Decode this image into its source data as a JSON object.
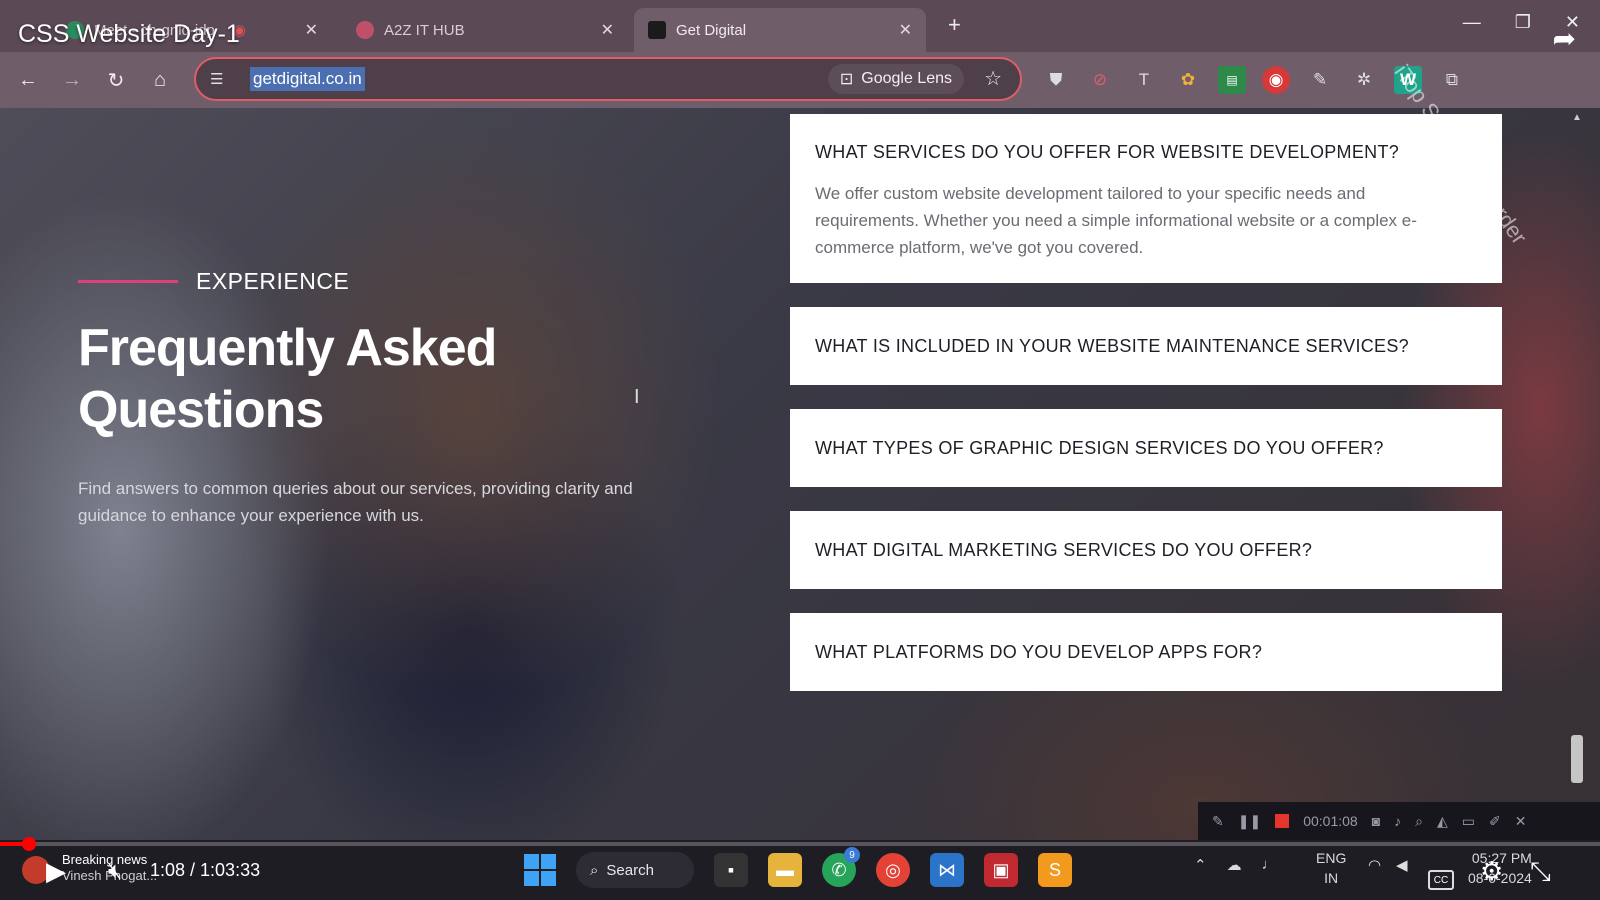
{
  "video": {
    "title": "CSS Website Day-1",
    "time_display": "1:08 / 1:03:33",
    "progress_fraction": 0.018
  },
  "browser": {
    "tabs": [
      {
        "label": "Meet - ch-gniq-jdp",
        "active": false
      },
      {
        "label": "A2Z IT HUB",
        "active": false
      },
      {
        "label": "Get Digital",
        "active": true
      }
    ],
    "url": "getdigital.co.in",
    "lens_label": "Google Lens"
  },
  "page": {
    "eyebrow": "EXPERIENCE",
    "heading": "Frequently Asked Questions",
    "subtext": "Find answers to common queries about our services, providing clarity and guidance to enhance your experience with us.",
    "faqs": [
      {
        "question": "WHAT SERVICES DO YOU OFFER FOR WEBSITE DEVELOPMENT?",
        "answer": "We offer custom website development tailored to your specific needs and requirements. Whether you need a simple informational website or a complex e-commerce platform, we've got you covered."
      },
      {
        "question": "WHAT IS INCLUDED IN YOUR WEBSITE MAINTENANCE SERVICES?"
      },
      {
        "question": "WHAT TYPES OF GRAPHIC DESIGN SERVICES DO YOU OFFER?"
      },
      {
        "question": "WHAT DIGITAL MARKETING SERVICES DO YOU OFFER?"
      },
      {
        "question": "WHAT PLATFORMS DO YOU DEVELOP APPS FOR?"
      }
    ],
    "accent_color": "#e0407a"
  },
  "overlays": {
    "watermark": "iTop Screen Recorder",
    "recorder_timer": "00:01:08"
  },
  "taskbar": {
    "search_label": "Search",
    "lang_line1": "ENG",
    "lang_line2": "IN",
    "clock_time": "05:27 PM",
    "clock_date": "08-0-2024",
    "whatsapp_badge": "9"
  },
  "notification": {
    "title": "Breaking news",
    "subtitle": "Vinesh Phogat..."
  }
}
